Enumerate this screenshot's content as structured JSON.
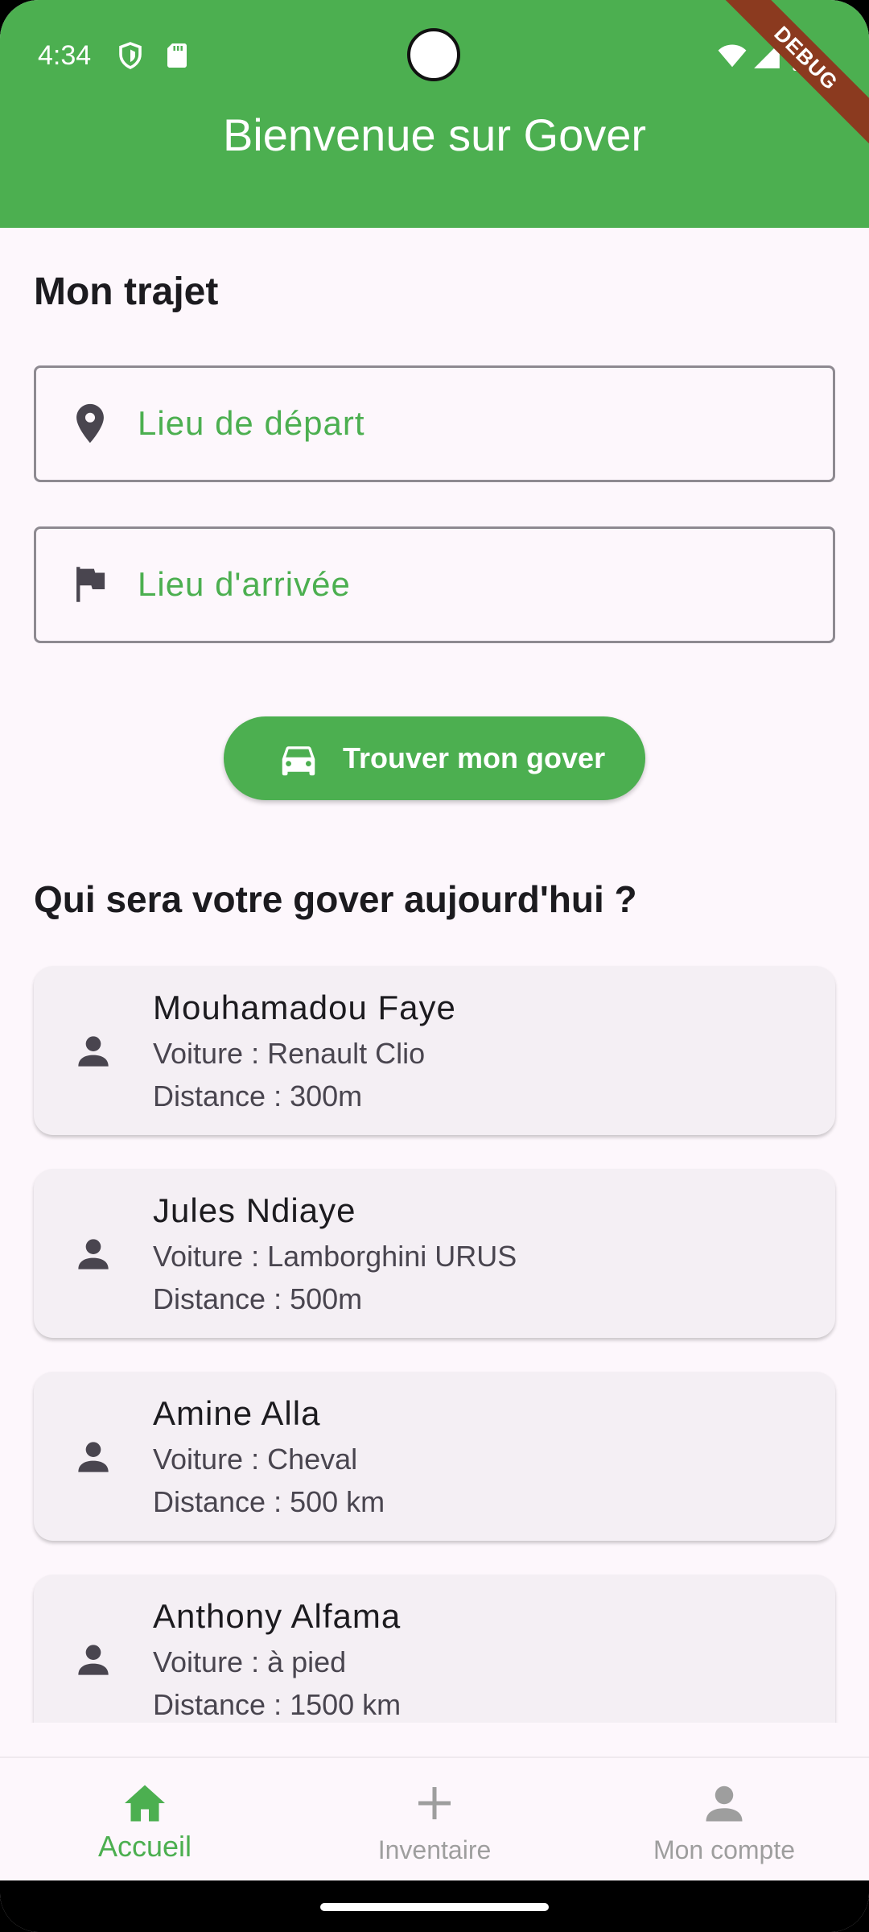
{
  "status_bar": {
    "time": "4:34"
  },
  "app_bar": {
    "title": "Bienvenue sur Gover",
    "debug_banner": "DEBUG"
  },
  "trip": {
    "title": "Mon trajet",
    "departure_placeholder": "Lieu de départ",
    "arrival_placeholder": "Lieu d'arrivée",
    "find_button_label": "Trouver mon gover"
  },
  "drivers": {
    "title": "Qui sera votre gover aujourd'hui ?",
    "items": [
      {
        "name": "Mouhamadou Faye",
        "car": "Voiture : Renault Clio",
        "distance": "Distance : 300m"
      },
      {
        "name": "Jules Ndiaye",
        "car": "Voiture : Lamborghini URUS",
        "distance": "Distance : 500m"
      },
      {
        "name": "Amine Alla",
        "car": "Voiture : Cheval",
        "distance": "Distance : 500 km"
      },
      {
        "name": "Anthony Alfama",
        "car": "Voiture : à pied",
        "distance": "Distance : 1500 km"
      }
    ]
  },
  "bottom_nav": {
    "items": [
      {
        "label": "Accueil",
        "icon": "home-icon",
        "active": true
      },
      {
        "label": "Inventaire",
        "icon": "plus-icon",
        "active": false
      },
      {
        "label": "Mon compte",
        "icon": "person-icon",
        "active": false
      }
    ]
  },
  "colors": {
    "primary": "#4CAF50",
    "background": "#FDF7FC",
    "card": "#F4EFF4",
    "debug": "#8B3A1F"
  }
}
